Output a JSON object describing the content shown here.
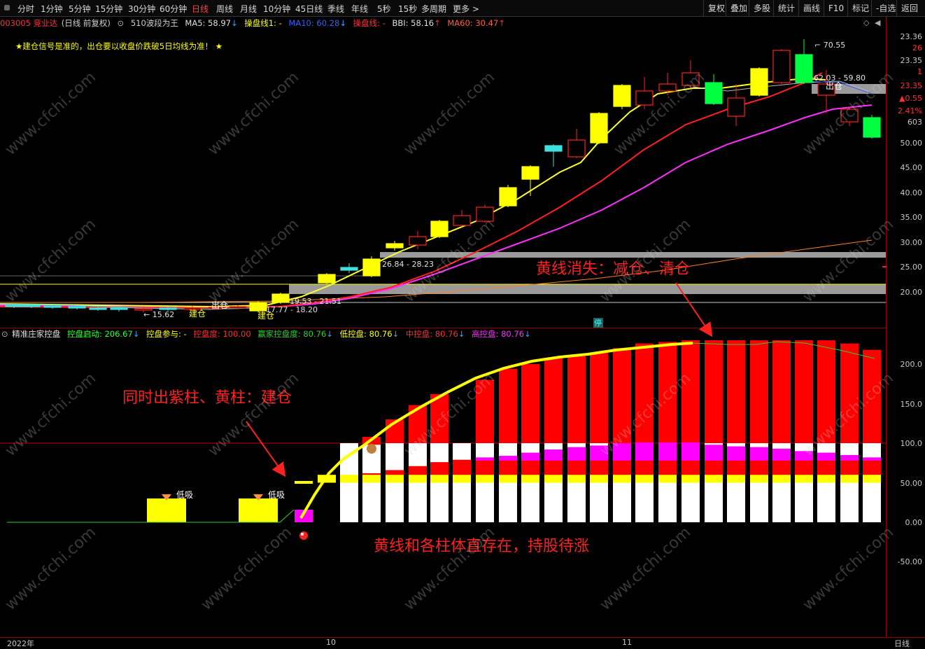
{
  "toolbar": {
    "periods": [
      "分时",
      "1分钟",
      "5分钟",
      "15分钟",
      "30分钟",
      "60分钟",
      "日线",
      "周线",
      "月线",
      "10分钟",
      "45日线",
      "季线",
      "年线",
      "5秒",
      "15秒",
      "多周期",
      "更多 >"
    ],
    "active_index": 6,
    "right_items": [
      "复权",
      "叠加",
      "多股",
      "统计",
      "画线",
      "F10",
      "标记",
      "-自选",
      "返回"
    ]
  },
  "main_info": {
    "code_name": "003005 竞业达",
    "mode": "(日线 前复权)",
    "indicator": "510波段为王",
    "ma5": "MA5: 58.97",
    "line1": "操盘线1: -",
    "ma10": "MA10: 60.28",
    "line2": "操盘线: -",
    "bbi": "BBI: 58.16",
    "ma60": "MA60: 30.47"
  },
  "notice": "★建仓信号是准的，出仓要以收盘价跌破5日均线为准！ ★",
  "chart_labels": {
    "high": "70.55",
    "range_top": "62.03 - 59.80",
    "exit_top": "出仓",
    "range_mid": "26.84 - 28.23",
    "range_low": "19.53 - 21.51",
    "range_low2": "17.77 - 18.20",
    "low": "15.62",
    "build1": "建仓",
    "exit1": "出仓",
    "build2": "建仓",
    "stop_tag": "停"
  },
  "right_axis_main": {
    "top_values": [
      "23.36",
      "26",
      "23.35",
      "1",
      "23.35",
      "▲0.55",
      "2.41%",
      "603"
    ],
    "ticks": [
      "50.00",
      "45.00",
      "40.00",
      "35.00",
      "30.00",
      "25.00",
      "20.00"
    ]
  },
  "sub_info": {
    "name": "精准庄家控盘",
    "start": "控盘启动: 206.67",
    "join": "控盘参与: -",
    "degree": "控盘度: 100.00",
    "win": "赢家控盘度: 80.76",
    "low": "低控盘: 80.76",
    "mid": "中控盘: 80.76",
    "high": "高控盘: 80.76"
  },
  "right_axis_sub": [
    "200.0",
    "150.0",
    "100.0",
    "50.00",
    "0.00",
    "-50.00"
  ],
  "sub_labels": {
    "dip": "低吸"
  },
  "annotations": {
    "top": "黄线消失：减仓、清仓",
    "left": "同时出紫柱、黄柱：建仓",
    "bottom": "黄线和各柱体直存在，持股待涨"
  },
  "bottom": {
    "year": "2022年",
    "month1": "10",
    "month2": "11",
    "period": "日线"
  },
  "watermark": "www.cfchi.com",
  "colors": {
    "up_candle": "#ff2020",
    "yellow_candle": "#ffff00",
    "green_candle": "#00ff40",
    "ma5": "#ffff30",
    "ma10": "#ff2020",
    "ma20": "#ff30ff",
    "ma60": "#ff8020",
    "grid_line": "#8b0000",
    "annotation": "#ff2020"
  }
}
